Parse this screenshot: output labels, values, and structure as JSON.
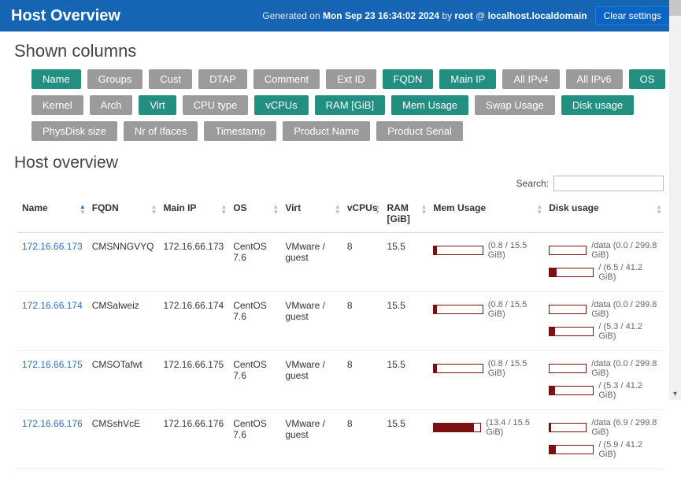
{
  "header": {
    "title": "Host Overview",
    "generated_prefix": "Generated on ",
    "generated_date": "Mon Sep 23 16:34:02 2024",
    "by_text": " by ",
    "user": "root",
    "at_text": " @ ",
    "host": "localhost.localdomain",
    "clear_btn": "Clear settings"
  },
  "columns_section": {
    "title": "Shown columns",
    "chips": [
      {
        "label": "Name",
        "on": true
      },
      {
        "label": "Groups",
        "on": false
      },
      {
        "label": "Cust",
        "on": false
      },
      {
        "label": "DTAP",
        "on": false
      },
      {
        "label": "Comment",
        "on": false
      },
      {
        "label": "Ext ID",
        "on": false
      },
      {
        "label": "FQDN",
        "on": true
      },
      {
        "label": "Main IP",
        "on": true
      },
      {
        "label": "All IPv4",
        "on": false
      },
      {
        "label": "All IPv6",
        "on": false
      },
      {
        "label": "OS",
        "on": true
      },
      {
        "label": "Kernel",
        "on": false
      },
      {
        "label": "Arch",
        "on": false
      },
      {
        "label": "Virt",
        "on": true
      },
      {
        "label": "CPU type",
        "on": false
      },
      {
        "label": "vCPUs",
        "on": true
      },
      {
        "label": "RAM [GiB]",
        "on": true
      },
      {
        "label": "Mem Usage",
        "on": true
      },
      {
        "label": "Swap Usage",
        "on": false
      },
      {
        "label": "Disk usage",
        "on": true
      },
      {
        "label": "PhysDisk size",
        "on": false
      },
      {
        "label": "Nr of Ifaces",
        "on": false
      },
      {
        "label": "Timestamp",
        "on": false
      },
      {
        "label": "Product Name",
        "on": false
      },
      {
        "label": "Product Serial",
        "on": false
      }
    ]
  },
  "overview": {
    "title": "Host overview",
    "search_label": "Search:",
    "search_value": "",
    "table_headers": [
      "Name",
      "FQDN",
      "Main IP",
      "OS",
      "Virt",
      "vCPUs",
      "RAM [GiB]",
      "Mem Usage",
      "Disk usage"
    ],
    "rows": [
      {
        "name": "172.16.66.173",
        "fqdn": "CMSNNGVYQ",
        "main_ip": "172.16.66.173",
        "os": "CentOS 7.6",
        "virt": "VMware / guest",
        "vcpus": "8",
        "ram": "15.5",
        "mem": {
          "pct": 6,
          "label": "(0.8 / 15.5 GiB)"
        },
        "disks": [
          {
            "pct": 0,
            "label": "/data (0.0 / 299.8 GiB)"
          },
          {
            "pct": 16,
            "label": "/ (6.5 / 41.2 GiB)"
          }
        ]
      },
      {
        "name": "172.16.66.174",
        "fqdn": "CMSalweiz",
        "main_ip": "172.16.66.174",
        "os": "CentOS 7.6",
        "virt": "VMware / guest",
        "vcpus": "8",
        "ram": "15.5",
        "mem": {
          "pct": 6,
          "label": "(0.8 / 15.5 GiB)"
        },
        "disks": [
          {
            "pct": 0,
            "label": "/data (0.0 / 299.8 GiB)"
          },
          {
            "pct": 13,
            "label": "/ (5.3 / 41.2 GiB)"
          }
        ]
      },
      {
        "name": "172.16.66.175",
        "fqdn": "CMSOTafwt",
        "main_ip": "172.16.66.175",
        "os": "CentOS 7.6",
        "virt": "VMware / guest",
        "vcpus": "8",
        "ram": "15.5",
        "mem": {
          "pct": 6,
          "label": "(0.8 / 15.5 GiB)"
        },
        "disks": [
          {
            "pct": 0,
            "label": "/data (0.0 / 299.8 GiB)"
          },
          {
            "pct": 13,
            "label": "/ (5.3 / 41.2 GiB)"
          }
        ]
      },
      {
        "name": "172.16.66.176",
        "fqdn": "CMSshVcE",
        "main_ip": "172.16.66.176",
        "os": "CentOS 7.6",
        "virt": "VMware / guest",
        "vcpus": "8",
        "ram": "15.5",
        "mem": {
          "pct": 86,
          "label": "(13.4 / 15.5 GiB)"
        },
        "disks": [
          {
            "pct": 3,
            "label": "/data (6.9 / 299.8 GiB)"
          },
          {
            "pct": 14,
            "label": "/ (5.9 / 41.2 GiB)"
          }
        ]
      }
    ]
  }
}
